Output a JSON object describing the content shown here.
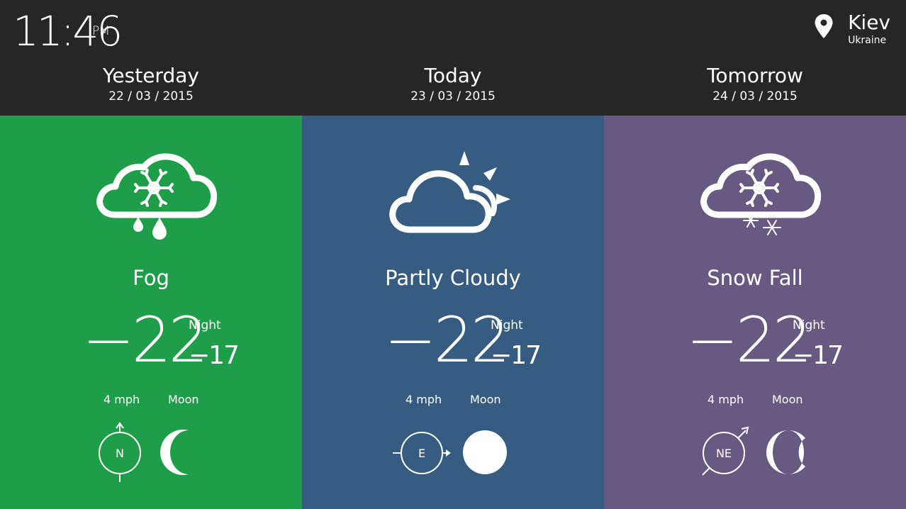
{
  "header": {
    "time": "11:46",
    "ampm": "PM",
    "city": "Kiev",
    "country": "Ukraine",
    "location_icon": "location-pin-icon"
  },
  "days": [
    {
      "name": "Yesterday",
      "date": "22 / 03 / 2015",
      "color": "#1e9e49",
      "icon": "fog-snow-rain-icon",
      "condition": "Fog",
      "temp": "−22",
      "night_label": "Night",
      "night_temp": "−17",
      "wind": "4 mph",
      "wind_dir": "N",
      "moon_label": "Moon",
      "moon_phase_icon": "crescent-moon-icon"
    },
    {
      "name": "Today",
      "date": "23 / 03 / 2015",
      "color": "#375c82",
      "icon": "partly-cloudy-icon",
      "condition": "Partly Cloudy",
      "temp": "−22",
      "night_label": "Night",
      "night_temp": "−17",
      "wind": "4 mph",
      "wind_dir": "E",
      "moon_label": "Moon",
      "moon_phase_icon": "full-moon-icon"
    },
    {
      "name": "Tomorrow",
      "date": "24 / 03 / 2015",
      "color": "#675982",
      "icon": "snow-fall-icon",
      "condition": "Snow Fall",
      "temp": "−22",
      "night_label": "Night",
      "night_temp": "−17",
      "wind": "4 mph",
      "wind_dir": "NE",
      "moon_label": "Moon",
      "moon_phase_icon": "gibbous-moon-icon"
    }
  ]
}
